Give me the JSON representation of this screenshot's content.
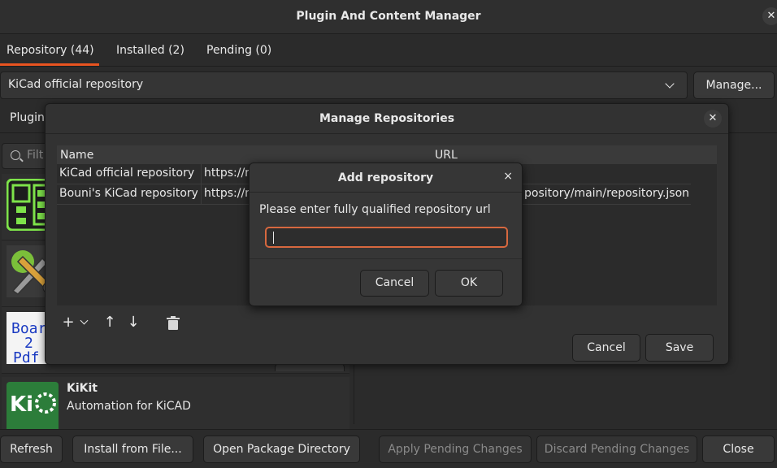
{
  "window": {
    "title": "Plugin And Content Manager"
  },
  "tabs": [
    {
      "label": "Repository (44)"
    },
    {
      "label": "Installed (2)"
    },
    {
      "label": "Pending (0)"
    }
  ],
  "repository": {
    "selected": "KiCad official repository",
    "manage_label": "Manage..."
  },
  "inner_tab": {
    "label": "Plugin"
  },
  "filter": {
    "placeholder": "Filt"
  },
  "packages": [
    {
      "icon": "board-layout-icon",
      "name": "",
      "desc": ""
    },
    {
      "icon": "tools-icon",
      "name": "",
      "desc": ""
    },
    {
      "icon": "board2pdf-icon",
      "name": "",
      "desc": ""
    },
    {
      "icon": "kikit-icon",
      "name": "KiKit",
      "desc": "Automation for KiCAD"
    }
  ],
  "bottom": {
    "refresh": "Refresh",
    "install_from_file": "Install from File...",
    "open_package_directory": "Open Package Directory",
    "apply_pending": "Apply Pending Changes",
    "discard_pending": "Discard Pending Changes",
    "close": "Close"
  },
  "manage_dialog": {
    "title": "Manage Repositories",
    "columns": {
      "name": "Name",
      "url": "URL"
    },
    "rows": [
      {
        "name": "KiCad official repository",
        "url": "https://r"
      },
      {
        "name": "Bouni's KiCad repository",
        "url": "https://r",
        "url_tail": "pository/main/repository.json"
      }
    ],
    "cancel": "Cancel",
    "save": "Save"
  },
  "add_dialog": {
    "title": "Add repository",
    "close_glyph": "×",
    "prompt": "Please enter fully qualified repository url",
    "input_value": "",
    "cancel": "Cancel",
    "ok": "OK"
  },
  "colors": {
    "accent": "#e95420",
    "focus": "#d7683f"
  }
}
